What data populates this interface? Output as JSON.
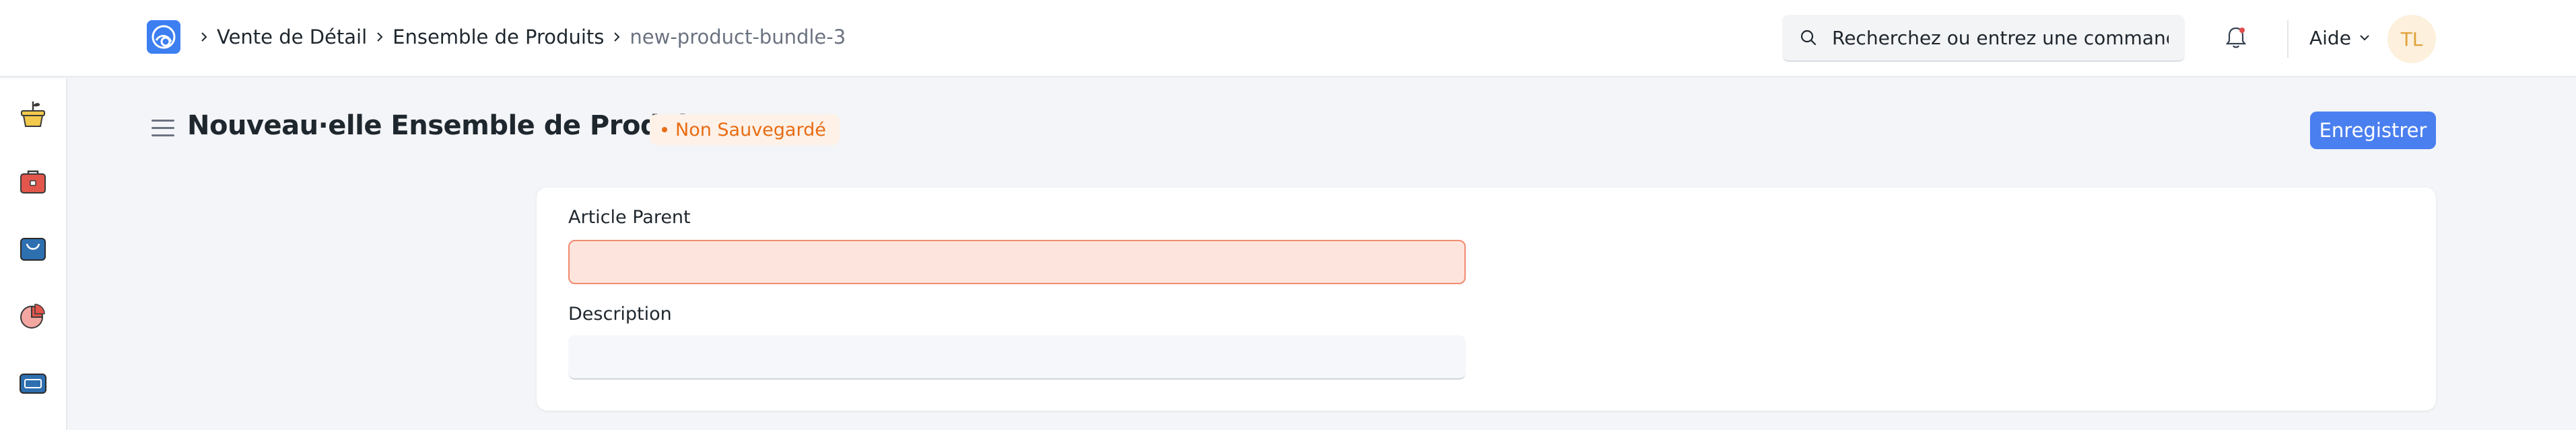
{
  "breadcrumb": {
    "items": [
      "Vente de Détail",
      "Ensemble de Produits"
    ],
    "current": "new-product-bundle-3"
  },
  "search": {
    "placeholder": "Recherchez ou entrez une commande"
  },
  "nav": {
    "help_label": "Aide",
    "avatar_initials": "TL"
  },
  "sidebar": {
    "icons": [
      "plant-pot-icon",
      "toolbox-icon",
      "basket-icon",
      "pie-chart-icon",
      "card-icon"
    ]
  },
  "page": {
    "title": "Nouveau·elle Ensemble de Produits",
    "status": "Non Sauvegardé",
    "save_label": "Enregistrer"
  },
  "form": {
    "parent_item_label": "Article Parent",
    "parent_item_value": "",
    "description_label": "Description",
    "description_value": ""
  },
  "colors": {
    "primary": "#4a7ff0",
    "status_orange": "#e86c13",
    "error_field_bg": "#fde5dd"
  }
}
